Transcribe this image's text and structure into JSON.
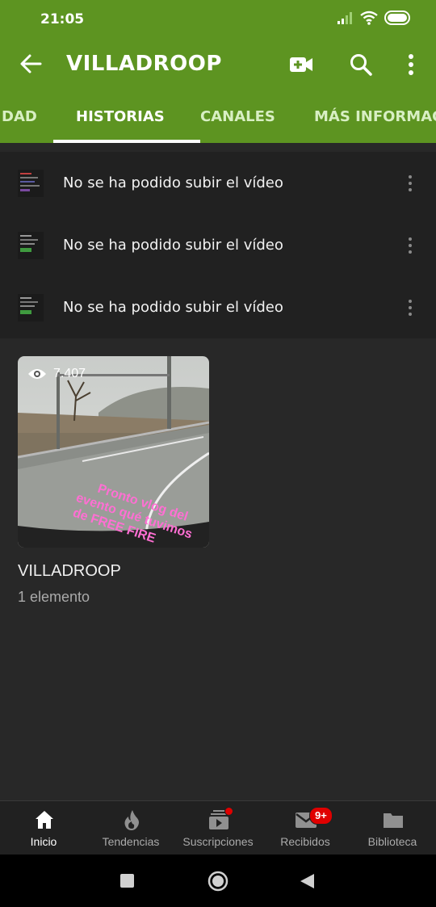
{
  "status": {
    "time": "21:05"
  },
  "app_bar": {
    "title": "VILLADROOP"
  },
  "tabs": [
    {
      "label": "DAD"
    },
    {
      "label": "HISTORIAS"
    },
    {
      "label": "CANALES"
    },
    {
      "label": "MÁS INFORMACI"
    }
  ],
  "uploads": [
    {
      "text": "No se ha podido subir el vídeo"
    },
    {
      "text": "No se ha podido subir el vídeo"
    },
    {
      "text": "No se ha podido subir el vídeo"
    }
  ],
  "story": {
    "views": "7.407",
    "overlay_text": "Pronto vlog del evento qué tuvimos de FREE FIRE",
    "title": "VILLADROOP",
    "count": "1 elemento"
  },
  "bottom_nav": [
    {
      "label": "Inicio"
    },
    {
      "label": "Tendencias"
    },
    {
      "label": "Suscripciones"
    },
    {
      "label": "Recibidos",
      "badge": "9+"
    },
    {
      "label": "Biblioteca"
    }
  ],
  "colors": {
    "accent": "#5d9421",
    "badge": "#e00000",
    "overlay_text": "#ff6fd3"
  }
}
